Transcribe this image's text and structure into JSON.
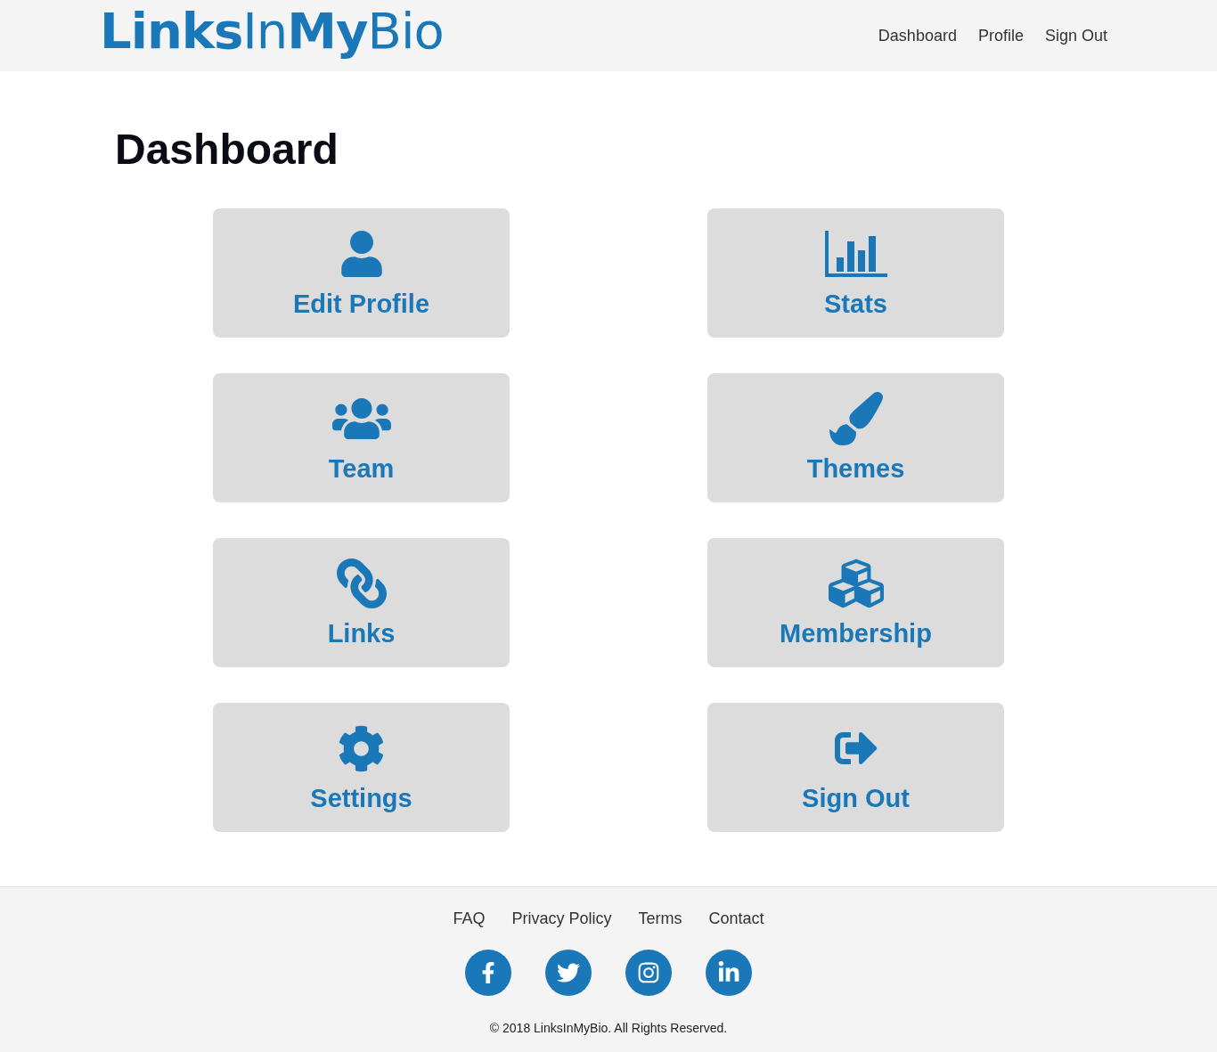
{
  "header": {
    "logo": "**Links**In**My**Bio",
    "nav": [
      "Dashboard",
      "Profile",
      "Sign Out"
    ]
  },
  "page": {
    "title": "Dashboard"
  },
  "tiles": [
    {
      "label": "Edit Profile"
    },
    {
      "label": "Stats"
    },
    {
      "label": "Team"
    },
    {
      "label": "Themes"
    },
    {
      "label": "Links"
    },
    {
      "label": "Membership"
    },
    {
      "label": "Settings"
    },
    {
      "label": "Sign Out"
    }
  ],
  "footer": {
    "links": [
      "FAQ",
      "Privacy Policy",
      "Terms",
      "Contact"
    ],
    "copyright": "© 2018 LinksInMyBio. All Rights Reserved."
  }
}
